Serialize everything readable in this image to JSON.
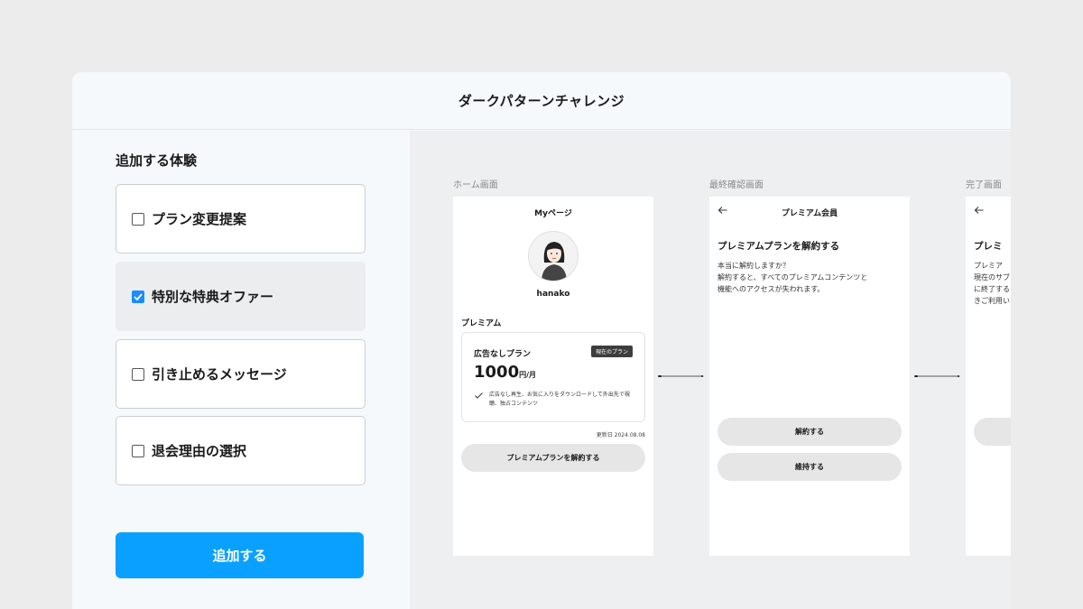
{
  "header": {
    "title": "ダークパターンチャレンジ"
  },
  "left": {
    "section_title": "追加する体験",
    "options": [
      {
        "label": "プラン変更提案",
        "checked": false
      },
      {
        "label": "特別な特典オファー",
        "checked": true
      },
      {
        "label": "引き止めるメッセージ",
        "checked": false
      },
      {
        "label": "退会理由の選択",
        "checked": false
      }
    ],
    "add_button": "追加する"
  },
  "screens": {
    "home": {
      "label": "ホーム画面",
      "title": "Myページ",
      "username": "hanako",
      "section": "プレミアム",
      "plan_name": "広告なしプラン",
      "plan_badge": "現在のプラン",
      "price": "1000",
      "unit": "円/月",
      "feature": "広告なし再生、お気に入りをダウンロードして外出先で視聴、独占コンテンツ",
      "updated": "更新日  2024.08.08",
      "cancel_button": "プレミアムプランを解約する"
    },
    "confirm": {
      "label": "最終確認画面",
      "title": "プレミアム会員",
      "heading": "プレミアムプランを解約する",
      "body": "本当に解約しますか？\n解約すると、すべてのプレミアムコンテンツと\n機能へのアクセスが失われます。",
      "cancel_button": "解約する",
      "keep_button": "維持する"
    },
    "complete": {
      "label": "完了画面",
      "heading": "プレミ",
      "body": "プレミア\n現在のサブ\nに終了する\nきご利用い"
    }
  },
  "colors": {
    "accent": "#0aa0ff",
    "checkbox": "#1a8cff"
  },
  "icons": {
    "back": "arrow-left-icon",
    "check": "check-icon",
    "checkbox": "checkbox-icon"
  }
}
